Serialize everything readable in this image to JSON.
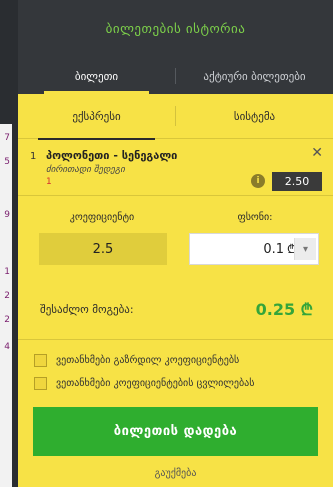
{
  "left_strip": {
    "numbers": [
      "7",
      "5",
      "9",
      "1",
      "2",
      "2",
      "4"
    ]
  },
  "header": {
    "title": "ბილეთების ისტორია"
  },
  "tabs": [
    {
      "label": "ბილეთი",
      "active": true
    },
    {
      "label": "აქტიური ბილეთები",
      "active": false
    }
  ],
  "subtabs": [
    {
      "label": "ექსპრესი",
      "active": true
    },
    {
      "label": "სისტემა",
      "active": false
    }
  ],
  "bet": {
    "index": "1",
    "match": "პოლონეთი - სენეგალი",
    "market": "ძირითადი შედეგი",
    "pick": "1",
    "odds": "2.50"
  },
  "form": {
    "coef_label": "კოეფიციენტი",
    "stake_label": "ფსონი:",
    "coef_value": "2.5",
    "stake_value": "0.1",
    "currency": "₾"
  },
  "win": {
    "label": "შესაძლო მოგება:",
    "value": "0.25 ₾"
  },
  "options": [
    "ვეთანხმები გაზრდილ კოეფიციენტებს",
    "ვეთანხმები კოეფიციენტების ცვლილებას"
  ],
  "place_button": "ბილეთის დადება",
  "cancel": "გაუქმება",
  "colors": {
    "panel_bg": "#f7e246",
    "dark_bar": "#34373b",
    "accent_green": "#2fae2f",
    "title_green": "#7dd14a",
    "odds_badge": "#3a3a3a"
  }
}
